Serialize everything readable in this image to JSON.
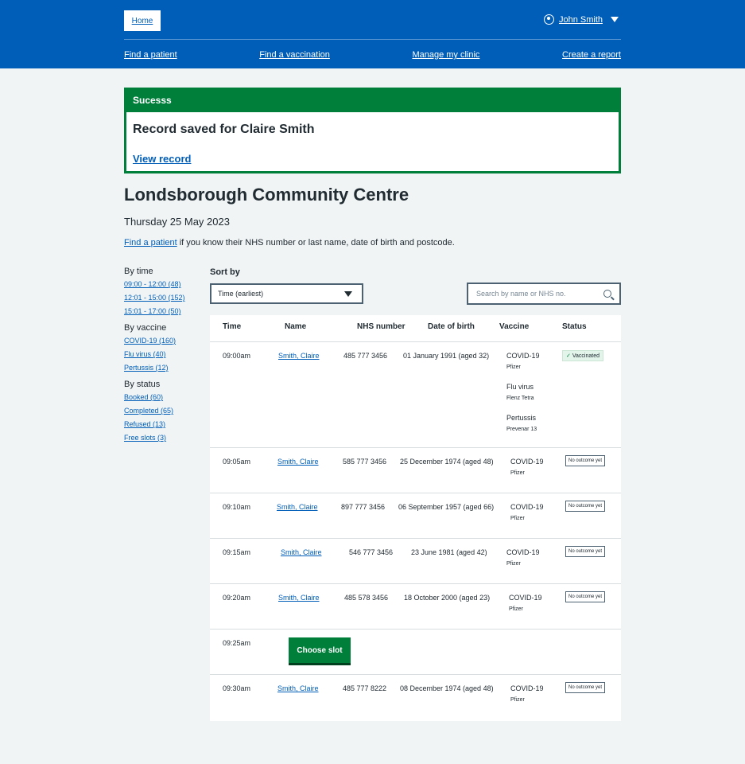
{
  "header": {
    "home": "Home",
    "user": "John Smith",
    "nav": [
      "Find a patient",
      "Find a vaccination",
      "Manage my clinic",
      "Create a report"
    ]
  },
  "success": {
    "heading": "Sucesss",
    "message": "Record saved for Claire Smith",
    "link": "View record"
  },
  "page": {
    "title": "Londsborough Community Centre",
    "date": "Thursday 25 May 2023",
    "intro_link": "Find a patient",
    "intro_text": " if you know their NHS number or last name, date of birth and postcode."
  },
  "filters": {
    "time_title": "By time",
    "time": [
      "09:00 - 12:00 (48)",
      "12:01 - 15:00 (152)",
      "15:01 - 17:00 (50)"
    ],
    "vaccine_title": "By vaccine",
    "vaccine": [
      "COVID-19 (160)",
      "Flu virus (40)",
      "Pertussis (12)"
    ],
    "status_title": "By status",
    "status": [
      "Booked (60)",
      "Completed (65)",
      "Refused (13)",
      "Free slots (3)"
    ]
  },
  "sort": {
    "label": "Sort by",
    "value": "Time (earliest)"
  },
  "search": {
    "placeholder": "Search by name or NHS no."
  },
  "table": {
    "headers": [
      "Time",
      "Name",
      "NHS number",
      "Date of birth",
      "Vaccine",
      "Status"
    ],
    "rows": [
      {
        "time": "09:00am",
        "name": "Smith, Claire",
        "nhs": "485 777 3456",
        "dob": "01 January 1991 (aged 32)",
        "vaccines": [
          {
            "name": "COVID-19",
            "brand": "Pfizer"
          },
          {
            "name": "Flu virus",
            "brand": "Flenz Tetra"
          },
          {
            "name": "Pertussis",
            "brand": "Prevenar 13"
          }
        ],
        "status": "Vaccinated"
      },
      {
        "time": "09:05am",
        "name": "Smith, Claire",
        "nhs": "585 777 3456",
        "dob": "25 December 1974 (aged 48)",
        "vaccines": [
          {
            "name": "COVID-19",
            "brand": "Pfizer"
          }
        ],
        "status": "No outcome yet"
      },
      {
        "time": "09:10am",
        "name": "Smith, Claire",
        "nhs": "897 777 3456",
        "dob": "06 September 1957 (aged 66)",
        "vaccines": [
          {
            "name": "COVID-19",
            "brand": "Pfizer"
          }
        ],
        "status": "No outcome yet"
      },
      {
        "time": "09:15am",
        "name": "Smith, Claire",
        "nhs": "546 777 3456",
        "dob": "23 June 1981 (aged 42)",
        "vaccines": [
          {
            "name": "COVID-19",
            "brand": "Pfizer"
          }
        ],
        "status": "No outcome yet"
      },
      {
        "time": "09:20am",
        "name": "Smith, Claire",
        "nhs": "485 578 3456",
        "dob": "18 October 2000 (aged 23)",
        "vaccines": [
          {
            "name": "COVID-19",
            "brand": "Pfizer"
          }
        ],
        "status": "No outcome yet"
      },
      {
        "time": "09:25am",
        "choose": "Choose slot"
      },
      {
        "time": "09:30am",
        "name": "Smith, Claire",
        "nhs": "485 777 8222",
        "dob": "08 December 1974 (aged 48)",
        "vaccines": [
          {
            "name": "COVID-19",
            "brand": "Pfizer"
          }
        ],
        "status": "No outcome yet"
      }
    ]
  },
  "colors": {
    "brand_blue": "#005eb8",
    "success_green": "#007f3b",
    "background": "#f0f4f5"
  },
  "icons": [
    "user-icon",
    "chevron-down-icon",
    "search-icon",
    "tick-icon"
  ]
}
